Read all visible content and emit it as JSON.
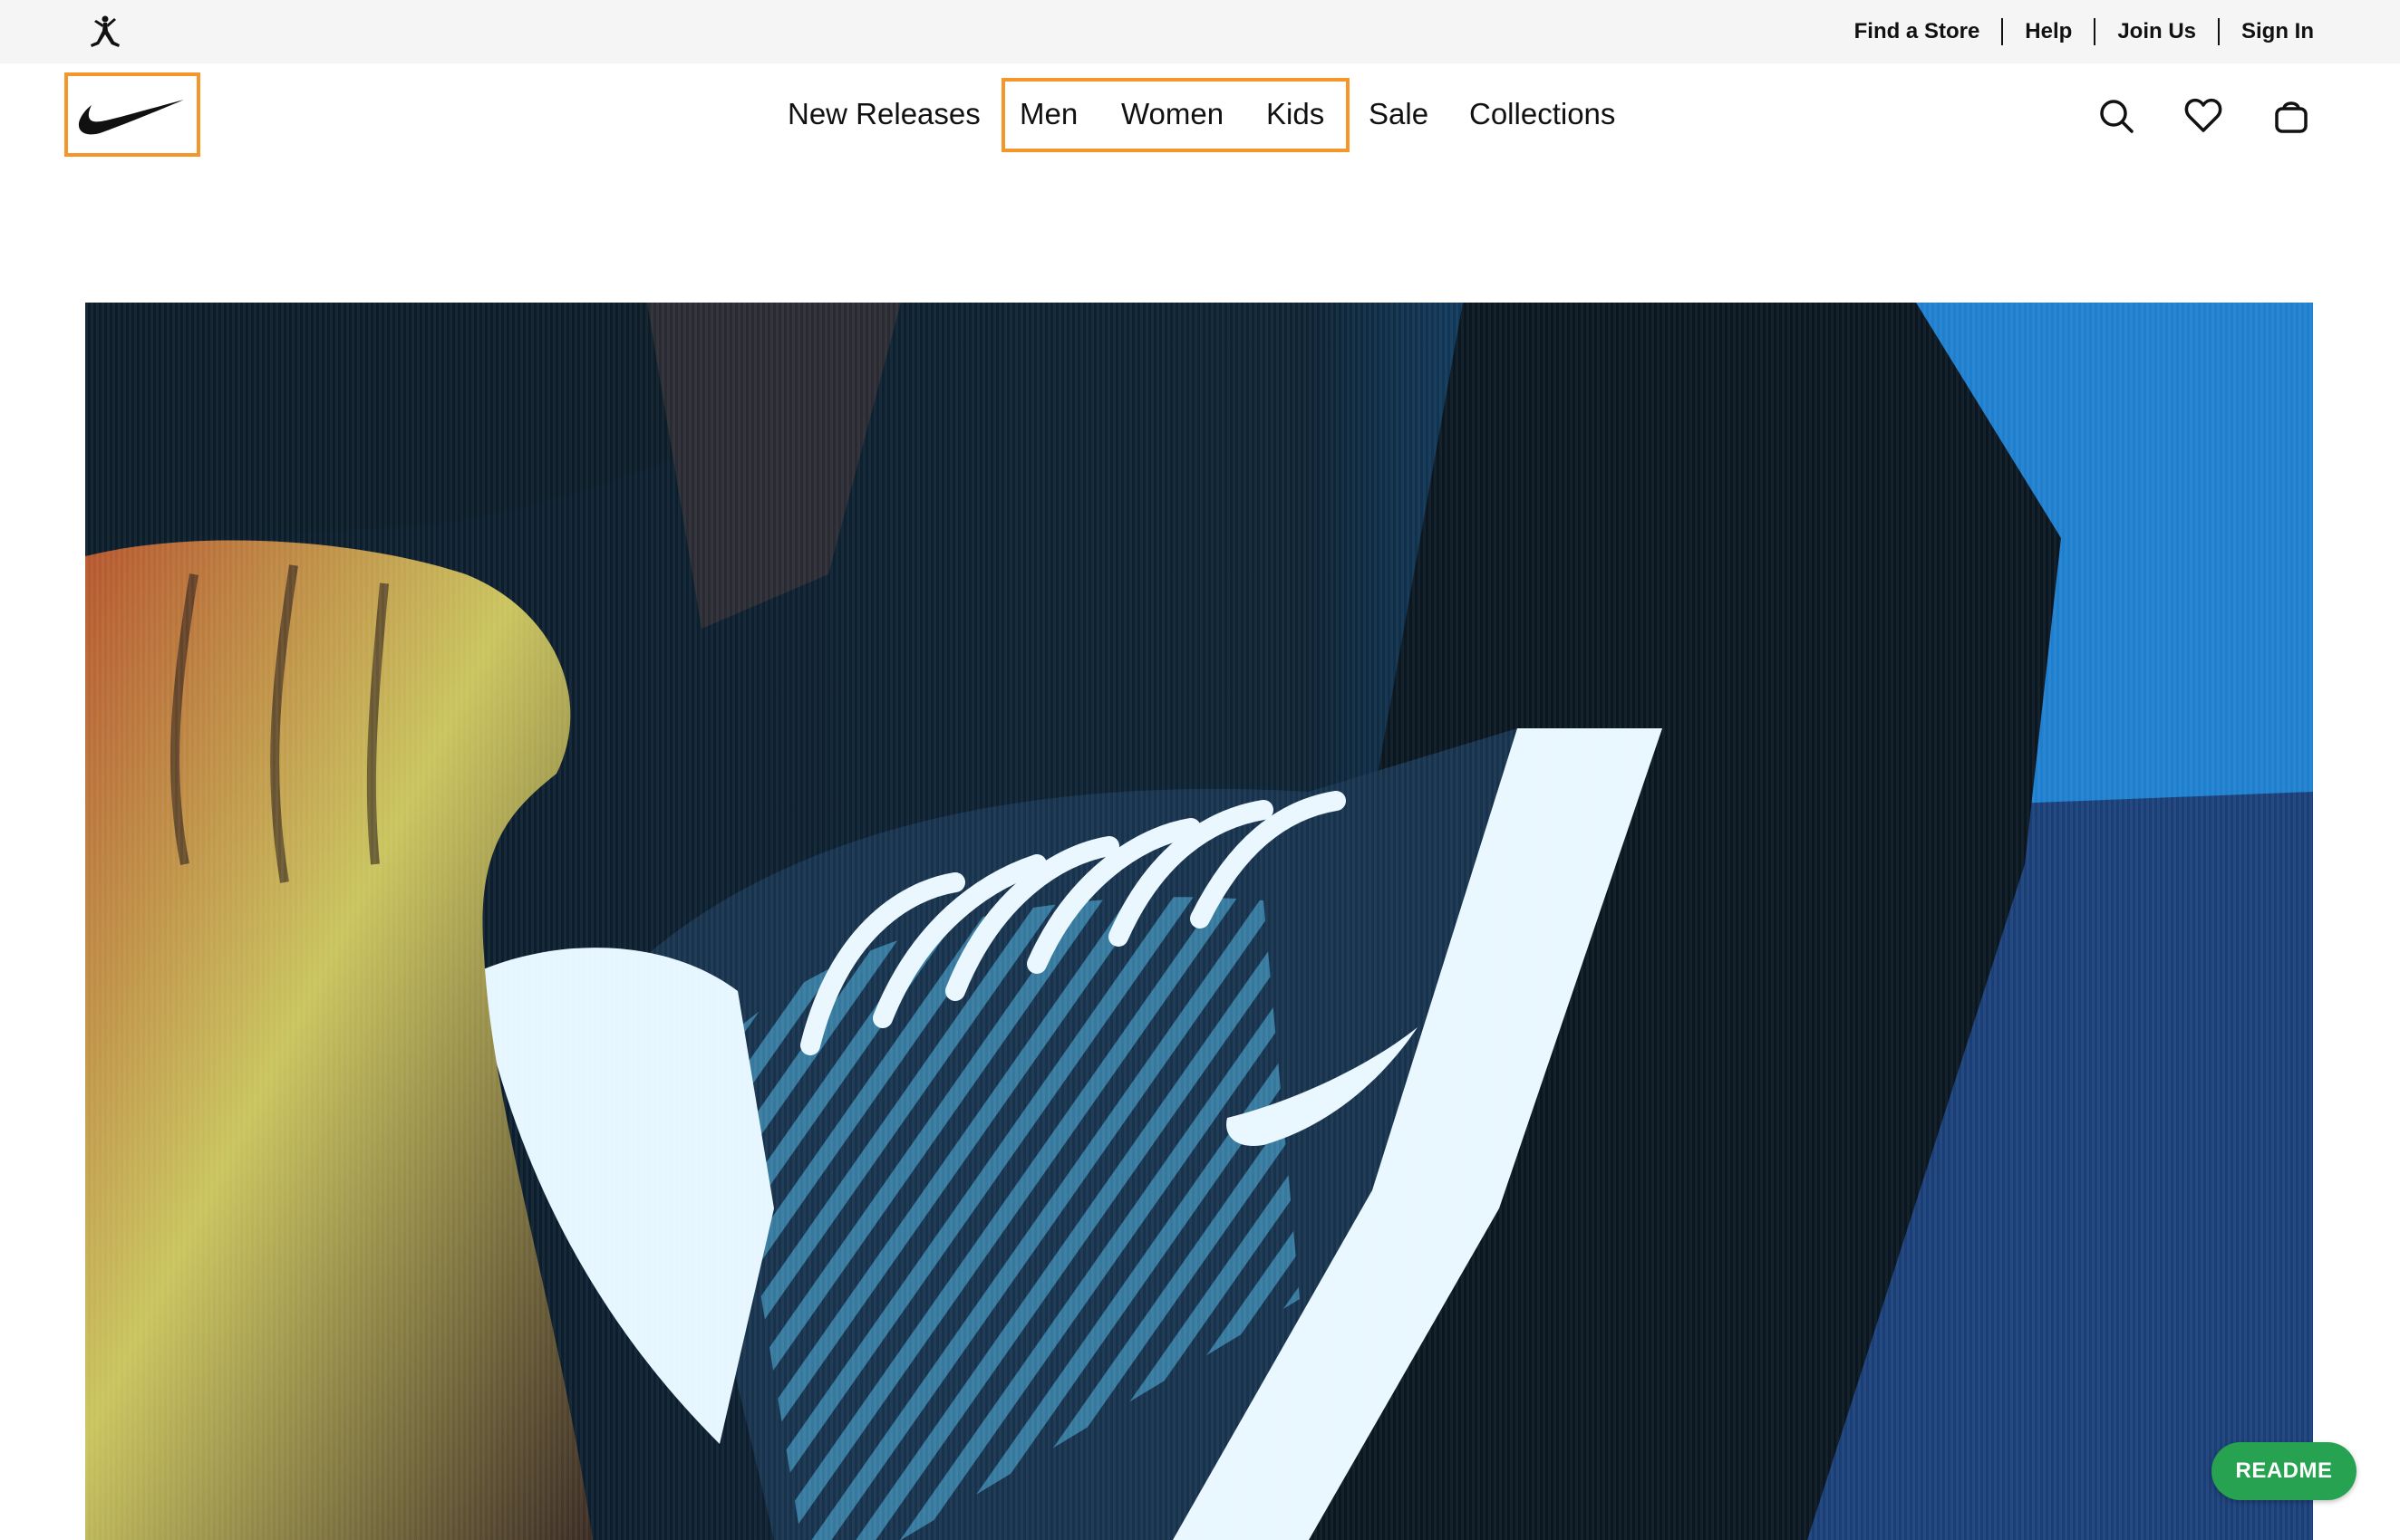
{
  "utility_bar": {
    "links": [
      "Find a Store",
      "Help",
      "Join Us",
      "Sign In"
    ]
  },
  "nav": {
    "items": [
      "New Releases",
      "Men",
      "Women",
      "Kids",
      "Sale",
      "Collections"
    ]
  },
  "icons": {
    "jordan": "jordan-jumpman-icon",
    "nike": "nike-swoosh-icon",
    "search": "search-icon",
    "favorites": "heart-icon",
    "bag": "bag-icon"
  },
  "colors": {
    "highlight": "#f5962a",
    "readme_bg": "#27a251",
    "utility_bg": "#f5f5f5"
  },
  "readme": {
    "label": "README"
  }
}
